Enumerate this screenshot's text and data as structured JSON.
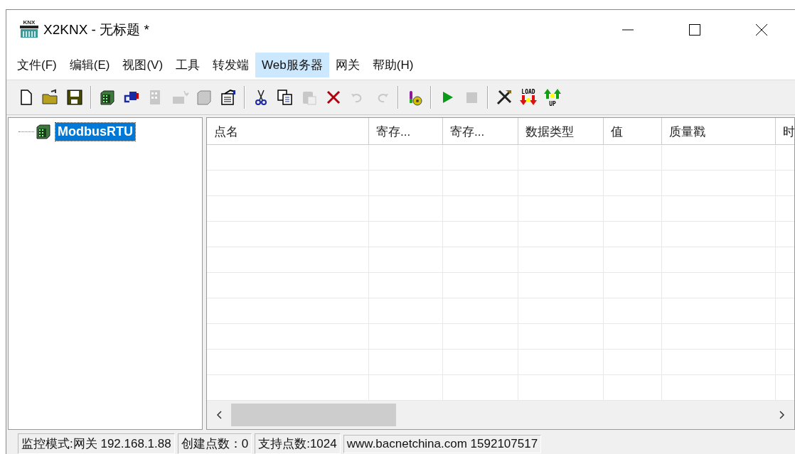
{
  "window": {
    "title": "X2KNX - 无标题 *",
    "icon_label": "KNX"
  },
  "menu": [
    {
      "label": "文件(F)",
      "selected": false
    },
    {
      "label": "编辑(E)",
      "selected": false
    },
    {
      "label": "视图(V)",
      "selected": false
    },
    {
      "label": "工具",
      "selected": false
    },
    {
      "label": "转发端",
      "selected": false
    },
    {
      "label": "Web服务器",
      "selected": true
    },
    {
      "label": "网关",
      "selected": false
    },
    {
      "label": "帮助(H)",
      "selected": false
    }
  ],
  "toolbar": [
    {
      "kind": "new",
      "disabled": false
    },
    {
      "kind": "open",
      "disabled": false
    },
    {
      "kind": "save",
      "disabled": false
    },
    {
      "kind": "sep"
    },
    {
      "kind": "device",
      "disabled": false
    },
    {
      "kind": "connect",
      "disabled": false
    },
    {
      "kind": "grid",
      "disabled": true
    },
    {
      "kind": "spark",
      "disabled": true
    },
    {
      "kind": "cube",
      "disabled": true
    },
    {
      "kind": "props",
      "disabled": false
    },
    {
      "kind": "sep"
    },
    {
      "kind": "cut",
      "disabled": false
    },
    {
      "kind": "copy",
      "disabled": false
    },
    {
      "kind": "paste",
      "disabled": true
    },
    {
      "kind": "delete",
      "disabled": false
    },
    {
      "kind": "undo",
      "disabled": true
    },
    {
      "kind": "redo",
      "disabled": true
    },
    {
      "kind": "sep"
    },
    {
      "kind": "bottle",
      "disabled": false
    },
    {
      "kind": "sep"
    },
    {
      "kind": "play",
      "disabled": false
    },
    {
      "kind": "stop",
      "disabled": true
    },
    {
      "kind": "sep"
    },
    {
      "kind": "tools",
      "disabled": false
    },
    {
      "kind": "load",
      "disabled": false,
      "label": "LOAD"
    },
    {
      "kind": "up",
      "disabled": false,
      "label": "UP"
    }
  ],
  "tree": [
    {
      "label": "ModbusRTU",
      "selected": true
    }
  ],
  "table": {
    "columns": [
      "点名",
      "寄存...",
      "寄存...",
      "数据类型",
      "值",
      "质量戳",
      "时"
    ]
  },
  "status_bar": [
    "监控模式:网关 192.168.1.88",
    "创建点数：0",
    "支持点数:1024",
    "www.bacnetchina.com 1592107517"
  ]
}
